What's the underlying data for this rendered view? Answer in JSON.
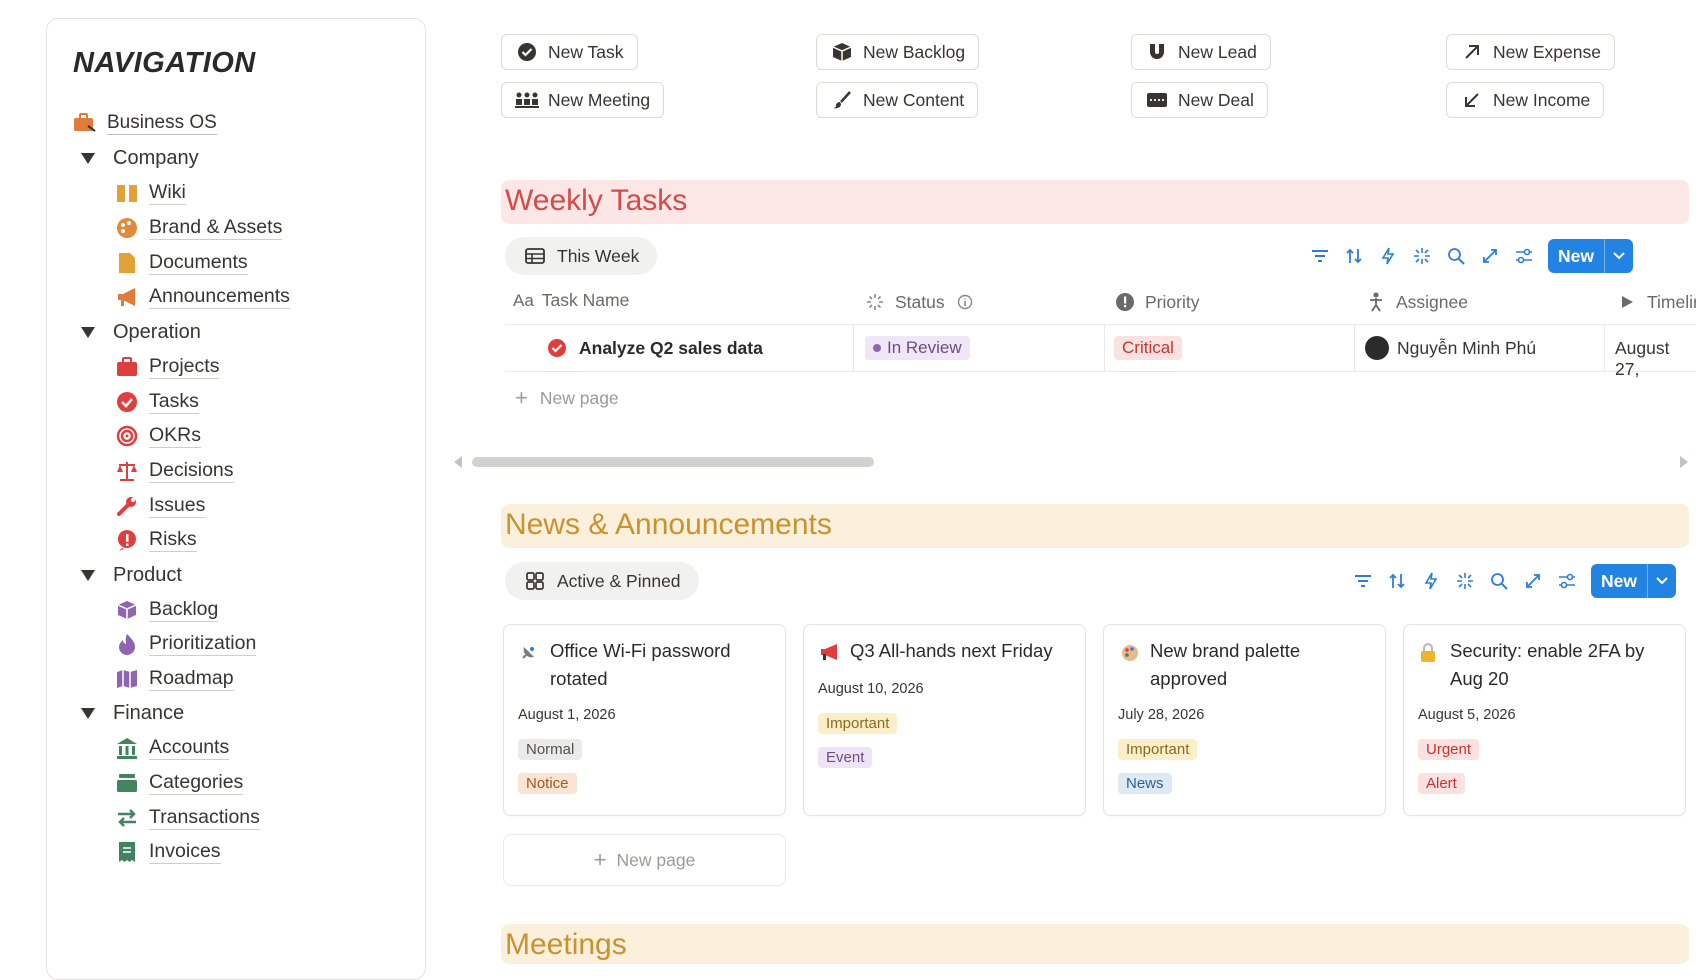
{
  "nav": {
    "title": "NAVIGATION",
    "root": "Business OS",
    "sections": [
      {
        "label": "Company",
        "items": [
          "Wiki",
          "Brand & Assets",
          "Documents",
          "Announcements"
        ]
      },
      {
        "label": "Operation",
        "items": [
          "Projects",
          "Tasks",
          "OKRs",
          "Decisions",
          "Issues",
          "Risks"
        ]
      },
      {
        "label": "Product",
        "items": [
          "Backlog",
          "Prioritization",
          "Roadmap"
        ]
      },
      {
        "label": "Finance",
        "items": [
          "Accounts",
          "Categories",
          "Transactions",
          "Invoices"
        ]
      }
    ]
  },
  "quick_actions": {
    "new_task": "New Task",
    "new_backlog": "New Backlog",
    "new_lead": "New Lead",
    "new_expense": "New Expense",
    "new_meeting": "New Meeting",
    "new_content": "New Content",
    "new_deal": "New Deal",
    "new_income": "New Income"
  },
  "weekly_tasks": {
    "title": "Weekly Tasks",
    "view": "This Week",
    "new_label": "New",
    "columns": [
      "Task Name",
      "Status",
      "Priority",
      "Assignee",
      "Timelir"
    ],
    "rows": [
      {
        "name": "Analyze Q2 sales data",
        "status": "In Review",
        "priority": "Critical",
        "assignee": "Nguyễn Minh Phú",
        "timeline": "August 27,"
      }
    ],
    "new_page": "New page"
  },
  "news": {
    "title": "News & Announcements",
    "view": "Active & Pinned",
    "new_label": "New",
    "cards": [
      {
        "title": "Office Wi-Fi password rotated",
        "date": "August 1, 2026",
        "tags": [
          "Normal",
          "Notice"
        ]
      },
      {
        "title": "Q3 All-hands next Friday",
        "date": "August 10, 2026",
        "tags": [
          "Important",
          "Event"
        ]
      },
      {
        "title": "New brand palette approved",
        "date": "July 28, 2026",
        "tags": [
          "Important",
          "News"
        ]
      },
      {
        "title": "Security: enable 2FA by Aug 20",
        "date": "August 5, 2026",
        "tags": [
          "Urgent",
          "Alert"
        ]
      }
    ],
    "new_page": "New page"
  },
  "meetings": {
    "title": "Meetings"
  },
  "colors": {
    "weekly_band": "#fde6e6",
    "weekly_title": "#d44c47",
    "news_band": "#fbf0dc",
    "news_title": "#cb912f",
    "accent_blue": "#2383e2"
  }
}
